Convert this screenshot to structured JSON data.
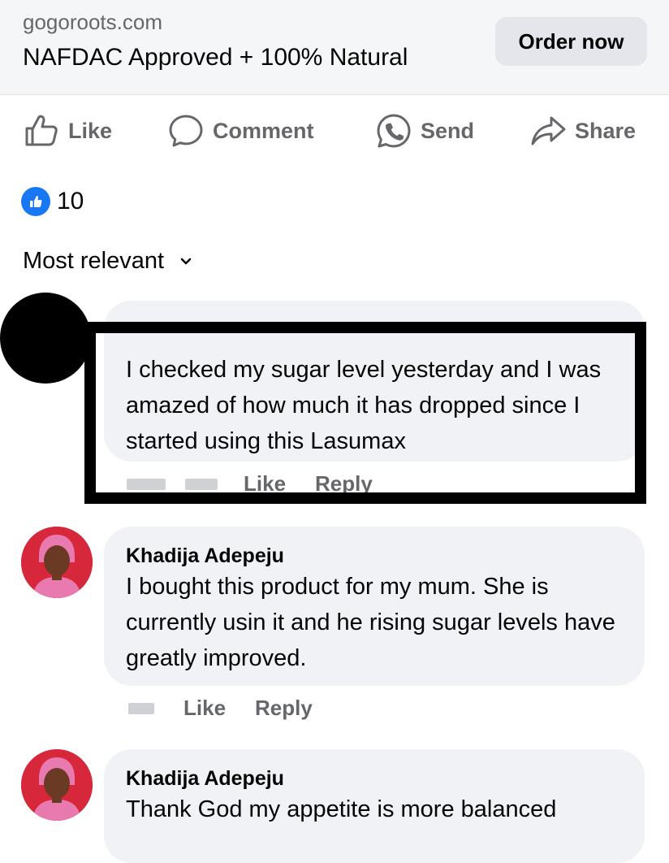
{
  "ad": {
    "domain": "gogoroots.com",
    "headline": "NAFDAC Approved + 100% Natural",
    "cta_label": "Order now"
  },
  "actions": {
    "like": "Like",
    "comment": "Comment",
    "send": "Send",
    "share": "Share"
  },
  "reactions": {
    "count": "10"
  },
  "sort": {
    "label": "Most relevant"
  },
  "comments": [
    {
      "author": "",
      "text": "I checked my sugar level yesterday and I was amazed of how much it has dropped since I started using this Lasumax",
      "like_label": "Like",
      "reply_label": "Reply"
    },
    {
      "author": "Khadija Adepeju",
      "text": "I bought this product for my mum. She is currently usin it and he rising sugar levels have greatly improved.",
      "like_label": "Like",
      "reply_label": "Reply"
    },
    {
      "author": "Khadija Adepeju",
      "text": "Thank God my appetite is more balanced"
    }
  ],
  "colors": {
    "facebook_blue": "#1877f2",
    "secondary_text": "#65676b",
    "bubble": "#f0f2f5"
  }
}
